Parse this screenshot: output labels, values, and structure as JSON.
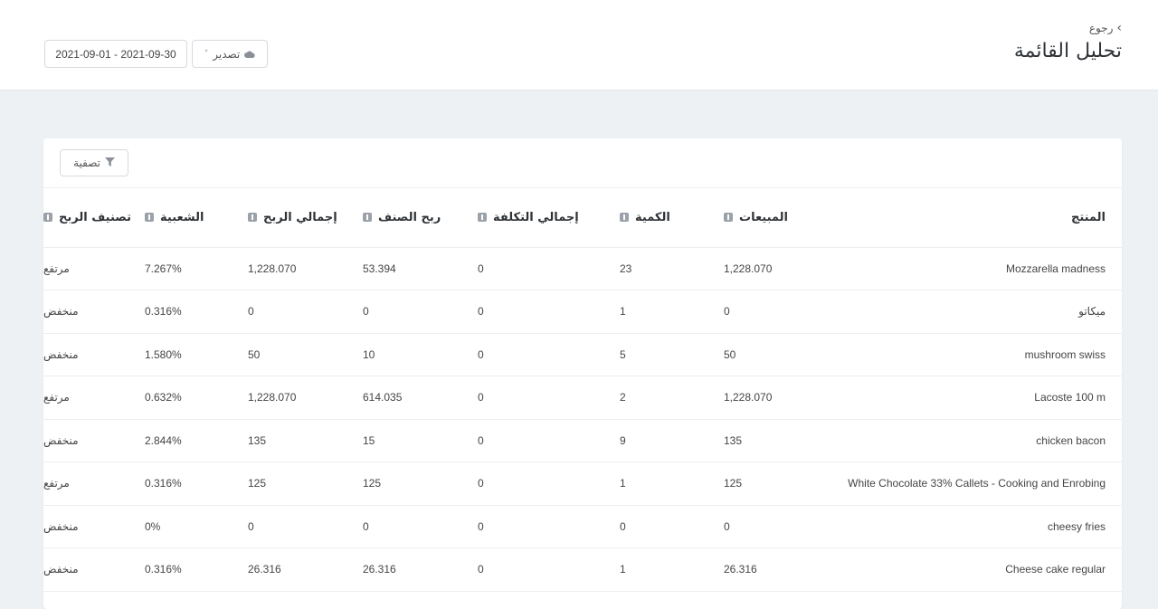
{
  "header": {
    "back_label": "رجوع",
    "title": "تحليل القائمة",
    "export_label": "تصدير",
    "date_range": "2021-09-01 - 2021-09-30"
  },
  "toolbar": {
    "filter_label": "تصفية"
  },
  "table": {
    "columns": [
      "المنتج",
      "المبيعات",
      "الكمية",
      "إجمالي التكلفة",
      "ربح الصنف",
      "إجمالي الربح",
      "الشعبية",
      "تصنيف الربح"
    ],
    "rows": [
      {
        "product": "Mozzarella madness",
        "sales": "1,228.070",
        "qty": "23",
        "cost": "0",
        "item_profit": "53.394",
        "total_profit": "1,228.070",
        "popularity": "7.267%",
        "class": "مرتفع"
      },
      {
        "product": "ميكاتو",
        "sales": "0",
        "qty": "1",
        "cost": "0",
        "item_profit": "0",
        "total_profit": "0",
        "popularity": "0.316%",
        "class": "منخفض"
      },
      {
        "product": "mushroom swiss",
        "sales": "50",
        "qty": "5",
        "cost": "0",
        "item_profit": "10",
        "total_profit": "50",
        "popularity": "1.580%",
        "class": "منخفض"
      },
      {
        "product": "Lacoste 100 m",
        "sales": "1,228.070",
        "qty": "2",
        "cost": "0",
        "item_profit": "614.035",
        "total_profit": "1,228.070",
        "popularity": "0.632%",
        "class": "مرتفع"
      },
      {
        "product": "chicken bacon",
        "sales": "135",
        "qty": "9",
        "cost": "0",
        "item_profit": "15",
        "total_profit": "135",
        "popularity": "2.844%",
        "class": "منخفض"
      },
      {
        "product": "White Chocolate 33% Callets - Cooking and Enrobing",
        "sales": "125",
        "qty": "1",
        "cost": "0",
        "item_profit": "125",
        "total_profit": "125",
        "popularity": "0.316%",
        "class": "مرتفع"
      },
      {
        "product": "cheesy fries",
        "sales": "0",
        "qty": "0",
        "cost": "0",
        "item_profit": "0",
        "total_profit": "0",
        "popularity": "0%",
        "class": "منخفض"
      },
      {
        "product": "Cheese cake regular",
        "sales": "26.316",
        "qty": "1",
        "cost": "0",
        "item_profit": "26.316",
        "total_profit": "26.316",
        "popularity": "0.316%",
        "class": "منخفض"
      }
    ]
  }
}
